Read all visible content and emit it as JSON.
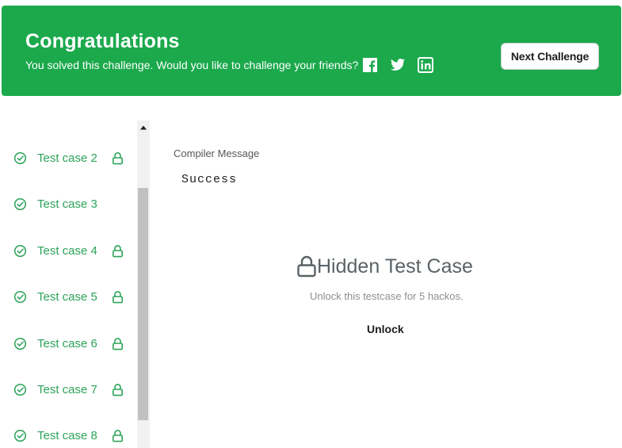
{
  "banner": {
    "title": "Congratulations",
    "subtitle": "You solved this challenge. Would you like to challenge your friends?",
    "social_icons": [
      "facebook-icon",
      "twitter-icon",
      "linkedin-icon"
    ],
    "next_button_label": "Next Challenge",
    "background_color": "#1ba94c"
  },
  "sidebar": {
    "status_color": "#2da35a",
    "test_cases": [
      {
        "label": "Test case 2",
        "status": "passed",
        "locked": true
      },
      {
        "label": "Test case 3",
        "status": "passed",
        "locked": false
      },
      {
        "label": "Test case 4",
        "status": "passed",
        "locked": true
      },
      {
        "label": "Test case 5",
        "status": "passed",
        "locked": true
      },
      {
        "label": "Test case 6",
        "status": "passed",
        "locked": true
      },
      {
        "label": "Test case 7",
        "status": "passed",
        "locked": true
      },
      {
        "label": "Test case 8",
        "status": "passed",
        "locked": true
      }
    ]
  },
  "main": {
    "compiler_message_label": "Compiler Message",
    "compiler_message_value": "Success",
    "hidden_title": "Hidden Test Case",
    "unlock_message": "Unlock this testcase for 5 hackos.",
    "unlock_button_label": "Unlock"
  }
}
